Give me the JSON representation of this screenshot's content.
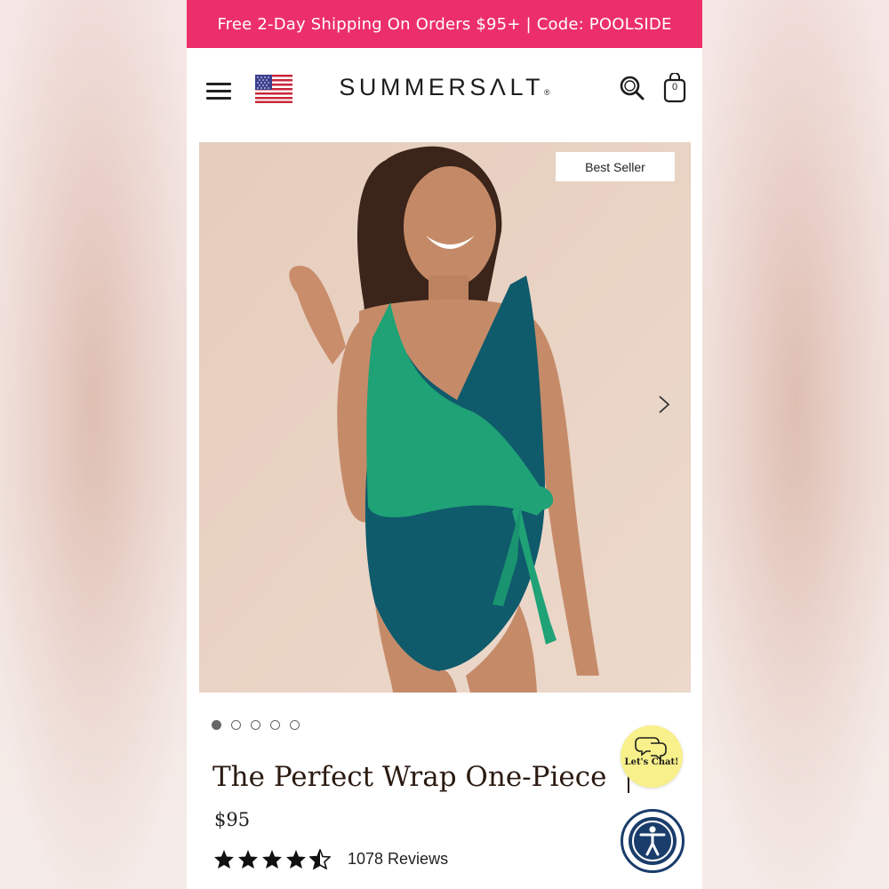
{
  "promo": {
    "text": "Free 2-Day Shipping On Orders $95+ | Code: POOLSIDE"
  },
  "header": {
    "menu_icon": "hamburger-menu-icon",
    "flag_icon": "us-flag-icon",
    "logo": "SUMMERSΛLT",
    "logo_mark": "®",
    "search_icon": "search-icon",
    "cart_icon": "shopping-bag-icon",
    "cart_count": "0"
  },
  "hero": {
    "badge": "Best Seller",
    "next_icon": "chevron-right-icon",
    "image_description": "model-wearing-two-tone-wrap-swimsuit",
    "swimsuit_colors": {
      "primary": "#0f5a6b",
      "accent": "#1fa276",
      "skin": "#c98b6a",
      "background": "#e9d2c3"
    }
  },
  "carousel": {
    "count": 5,
    "active_index": 0
  },
  "product": {
    "title": "The Perfect Wrap One-Piece",
    "price": "$95",
    "rating": 4.5,
    "reviews": "1078 Reviews"
  },
  "chat": {
    "label": "Let's Chat!",
    "icon": "chat-bubbles-icon"
  },
  "accessibility": {
    "icon": "accessibility-person-icon"
  },
  "colors": {
    "promo_bg": "#ec2f6b",
    "chat_bg": "#f8f08a",
    "a11y_blue": "#1a3d6b"
  }
}
